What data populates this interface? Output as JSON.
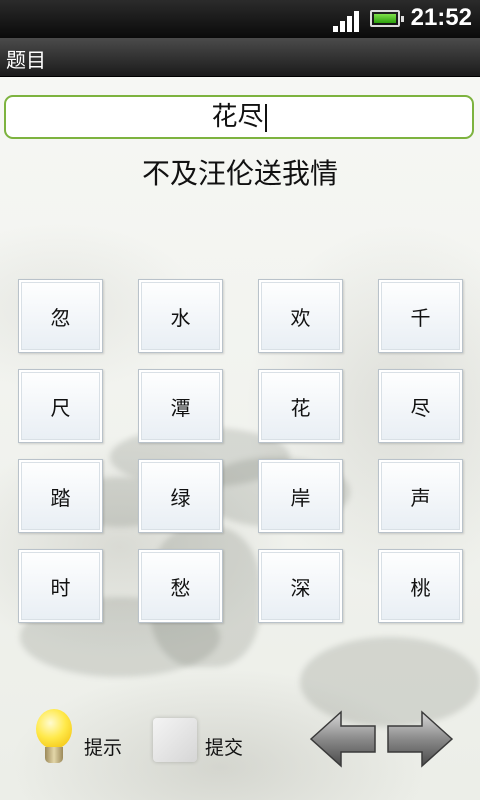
{
  "status_bar": {
    "time": "21:52"
  },
  "titlebar": {
    "title": "题目"
  },
  "answer": {
    "value": "花尽"
  },
  "clue": {
    "text": "不及汪伦送我情"
  },
  "grid": {
    "cells": [
      "忽",
      "水",
      "欢",
      "千",
      "尺",
      "潭",
      "花",
      "尽",
      "踏",
      "绿",
      "岸",
      "声",
      "时",
      "愁",
      "深",
      "桃"
    ]
  },
  "controls": {
    "hint_label": "提示",
    "submit_label": "提交"
  },
  "icons": {
    "hint": "lightbulb-icon",
    "submit": "blank-square-icon",
    "prev": "left-arrow-icon",
    "next": "right-arrow-icon"
  },
  "colors": {
    "input_border": "#7db33f"
  }
}
